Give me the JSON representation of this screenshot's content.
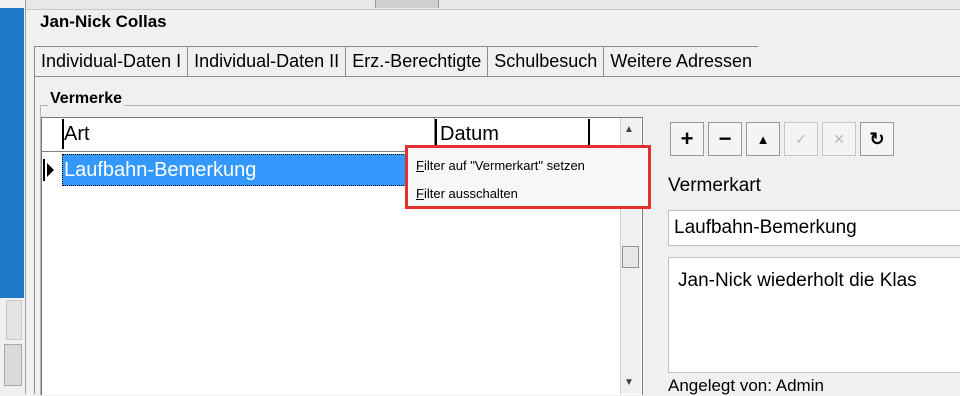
{
  "person_name": "Jan-Nick Collas",
  "tabs": [
    {
      "label": "Individual-Daten I"
    },
    {
      "label": "Individual-Daten II"
    },
    {
      "label": "Erz.-Berechtigte"
    },
    {
      "label": "Schulbesuch"
    },
    {
      "label": "Weitere Adressen"
    }
  ],
  "section_title": "Vermerke",
  "grid": {
    "columns": [
      "Art",
      "Datum"
    ],
    "rows": [
      {
        "art": "Laufbahn-Bemerkung",
        "datum": ""
      }
    ]
  },
  "context_menu": {
    "items": [
      {
        "accel": "F",
        "rest": "ilter auf \"Vermerkart\" setzen"
      },
      {
        "accel": "F",
        "rest": "ilter ausschalten"
      }
    ]
  },
  "toolbar": {
    "buttons": [
      {
        "icon": "plus-icon",
        "glyph": "+"
      },
      {
        "icon": "minus-icon",
        "glyph": "−"
      },
      {
        "icon": "triangle-up-icon",
        "glyph": "▲"
      },
      {
        "icon": "check-icon",
        "glyph": "✓"
      },
      {
        "icon": "x-icon",
        "glyph": "✕"
      },
      {
        "icon": "refresh-icon",
        "glyph": "↻"
      }
    ]
  },
  "detail": {
    "vermerkart_label": "Vermerkart",
    "vermerkart_value": "Laufbahn-Bemerkung",
    "memo_text": "Jan-Nick wiederholt die Klas",
    "angelegt_von": "Angelegt von:  Admin"
  },
  "colors": {
    "selection": "#3399ff",
    "menu_highlight_border": "#e03030",
    "accent_left_panel": "#1e78c8"
  }
}
